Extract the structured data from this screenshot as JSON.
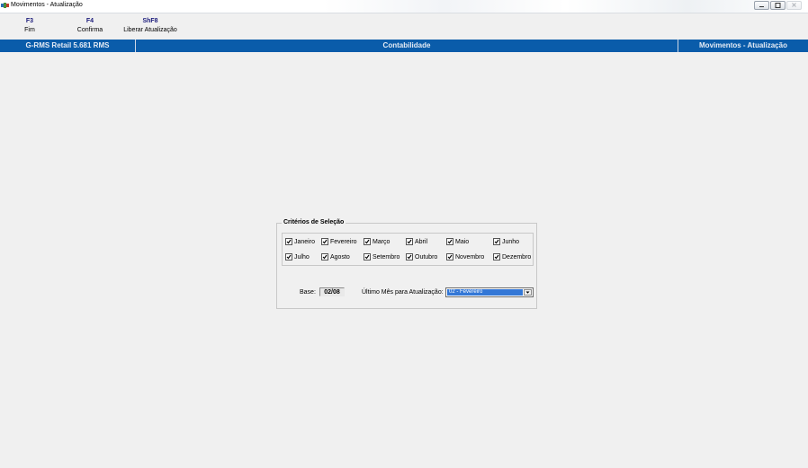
{
  "window": {
    "title": "Movimentos - Atualização",
    "controls": [
      "minimize-icon",
      "maximize-icon",
      "close-icon"
    ]
  },
  "toolbar": {
    "fim": {
      "key": "F3",
      "label": "Fim"
    },
    "confirma": {
      "key": "F4",
      "label": "Confirma"
    },
    "liberar": {
      "key": "ShF8",
      "label": "Liberar Atualização"
    }
  },
  "statusbar": {
    "left": "G-RMS Retail 5.681 RMS",
    "center": "Contabilidade",
    "right": "Movimentos - Atualização",
    "background": "#0a5caa"
  },
  "panel": {
    "title": "Critérios de Seleção",
    "months": [
      {
        "label": "Janeiro",
        "checked": true
      },
      {
        "label": "Fevereiro",
        "checked": true
      },
      {
        "label": "Março",
        "checked": true
      },
      {
        "label": "Abril",
        "checked": true
      },
      {
        "label": "Maio",
        "checked": true
      },
      {
        "label": "Junho",
        "checked": true
      },
      {
        "label": "Julho",
        "checked": true
      },
      {
        "label": "Agosto",
        "checked": true
      },
      {
        "label": "Setembro",
        "checked": true
      },
      {
        "label": "Outubro",
        "checked": true
      },
      {
        "label": "Novembro",
        "checked": true
      },
      {
        "label": "Dezembro",
        "checked": true
      }
    ],
    "base_label": "Base:",
    "base_value": "02/08",
    "ultimo_label": "Último Mês para Atualização:",
    "ultimo_value": "02 - Fevereiro",
    "selection_color": "#3377d6"
  }
}
